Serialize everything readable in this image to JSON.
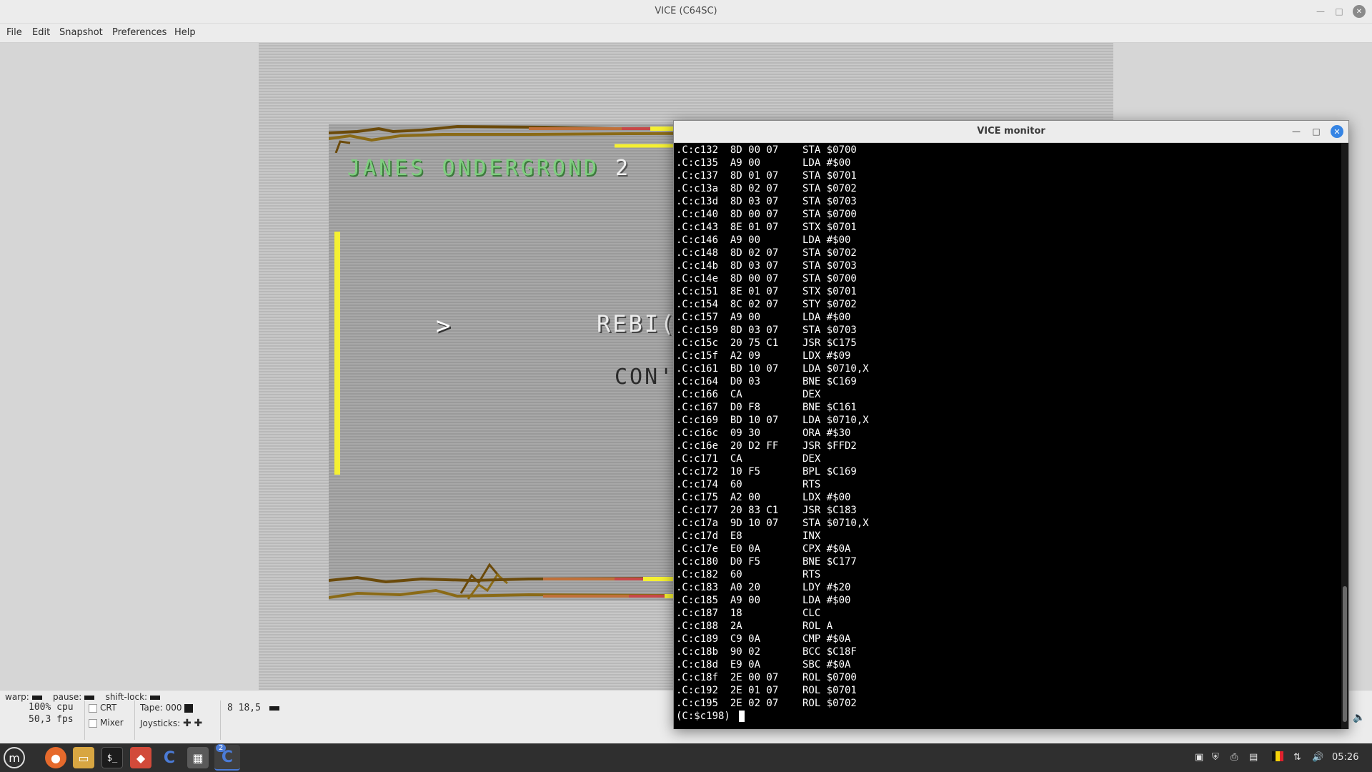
{
  "window": {
    "title": "VICE (C64SC)"
  },
  "menu": [
    "File",
    "Edit",
    "Snapshot",
    "Preferences",
    "Help"
  ],
  "game": {
    "title": "JANES ONDERGROND",
    "title_year": "2",
    "menu_line1": "REBI(",
    "menu_line2": "CON'",
    "arrow": ">"
  },
  "status": {
    "warp_label": "warp:",
    "pause_label": "pause:",
    "shiftlock_label": "shift-lock:",
    "cpu": "100% cpu",
    "fps": "50,3 fps",
    "crt_label": "CRT",
    "mixer_label": "Mixer",
    "tape_label": "Tape:",
    "tape_counter": "000",
    "joysticks_label": "Joysticks:",
    "drive": "8 18,5"
  },
  "monitor": {
    "title": "VICE monitor",
    "lines": [
      ".C:c132  8D 00 07    STA $0700",
      ".C:c135  A9 00       LDA #$00",
      ".C:c137  8D 01 07    STA $0701",
      ".C:c13a  8D 02 07    STA $0702",
      ".C:c13d  8D 03 07    STA $0703",
      ".C:c140  8D 00 07    STA $0700",
      ".C:c143  8E 01 07    STX $0701",
      ".C:c146  A9 00       LDA #$00",
      ".C:c148  8D 02 07    STA $0702",
      ".C:c14b  8D 03 07    STA $0703",
      ".C:c14e  8D 00 07    STA $0700",
      ".C:c151  8E 01 07    STX $0701",
      ".C:c154  8C 02 07    STY $0702",
      ".C:c157  A9 00       LDA #$00",
      ".C:c159  8D 03 07    STA $0703",
      ".C:c15c  20 75 C1    JSR $C175",
      ".C:c15f  A2 09       LDX #$09",
      ".C:c161  BD 10 07    LDA $0710,X",
      ".C:c164  D0 03       BNE $C169",
      ".C:c166  CA          DEX",
      ".C:c167  D0 F8       BNE $C161",
      ".C:c169  BD 10 07    LDA $0710,X",
      ".C:c16c  09 30       ORA #$30",
      ".C:c16e  20 D2 FF    JSR $FFD2",
      ".C:c171  CA          DEX",
      ".C:c172  10 F5       BPL $C169",
      ".C:c174  60          RTS",
      ".C:c175  A2 00       LDX #$00",
      ".C:c177  20 83 C1    JSR $C183",
      ".C:c17a  9D 10 07    STA $0710,X",
      ".C:c17d  E8          INX",
      ".C:c17e  E0 0A       CPX #$0A",
      ".C:c180  D0 F5       BNE $C177",
      ".C:c182  60          RTS",
      ".C:c183  A0 20       LDY #$20",
      ".C:c185  A9 00       LDA #$00",
      ".C:c187  18          CLC",
      ".C:c188  2A          ROL A",
      ".C:c189  C9 0A       CMP #$0A",
      ".C:c18b  90 02       BCC $C18F",
      ".C:c18d  E9 0A       SBC #$0A",
      ".C:c18f  2E 00 07    ROL $0700",
      ".C:c192  2E 01 07    ROL $0701",
      ".C:c195  2E 02 07    ROL $0702"
    ],
    "prompt": "(C:$c198) "
  },
  "taskbar": {
    "clock": "05:26",
    "badge": "2",
    "icons": [
      "menu-icon",
      "firefox-icon",
      "files-icon",
      "terminal-icon",
      "app-icon",
      "c64-icon",
      "calculator-icon",
      "vice-icon"
    ]
  }
}
